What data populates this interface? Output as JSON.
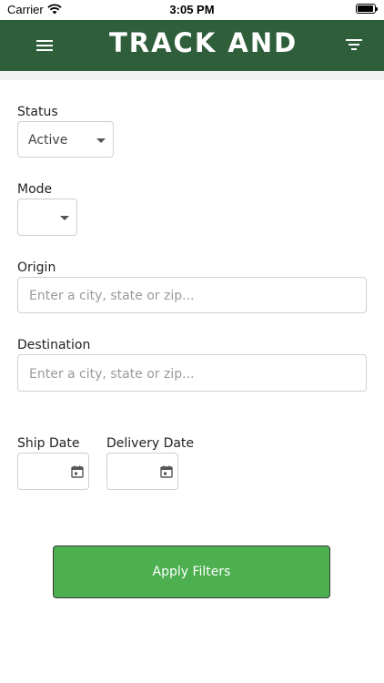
{
  "status_bar": {
    "carrier": "Carrier",
    "time": "3:05 PM"
  },
  "header": {
    "title": "TRACK AND",
    "menu_icon": "hamburger-menu-icon",
    "filter_icon": "filter-icon",
    "background": "#2e5e3a"
  },
  "form": {
    "status": {
      "label": "Status",
      "value": "Active"
    },
    "mode": {
      "label": "Mode",
      "value": ""
    },
    "origin": {
      "label": "Origin",
      "placeholder": "Enter a city, state or zip..."
    },
    "destination": {
      "label": "Destination",
      "placeholder": "Enter a city, state or zip..."
    },
    "ship_date": {
      "label": "Ship Date",
      "icon": "calendar-icon"
    },
    "delivery_date": {
      "label": "Delivery Date",
      "icon": "calendar-icon"
    }
  },
  "apply_button": {
    "label": "Apply Filters",
    "color": "#4caf50"
  }
}
